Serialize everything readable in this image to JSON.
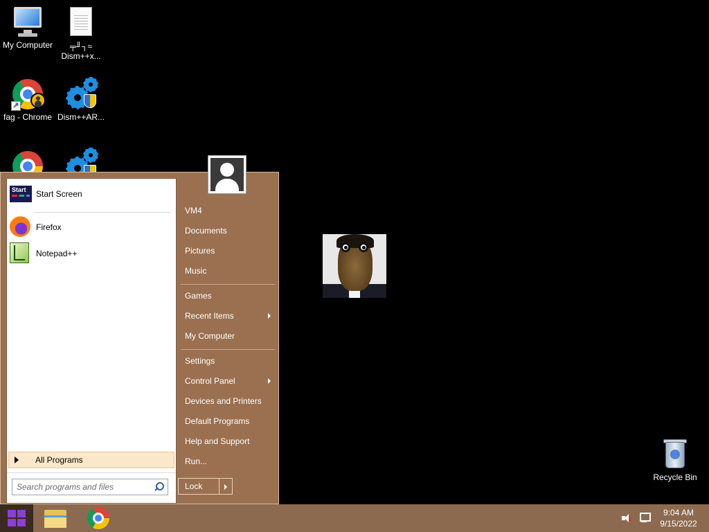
{
  "desktop": {
    "icons": [
      {
        "label": "My Computer",
        "icon": "computer-icon"
      },
      {
        "label": "╤╜┐≈",
        "label2": "Dism++x...",
        "icon": "document-icon"
      },
      {
        "label": "fag - Chrome",
        "icon": "chrome-icon"
      },
      {
        "label": "Dism++AR...",
        "icon": "gear-icon"
      },
      {
        "label": "",
        "icon": "chrome-icon"
      },
      {
        "label": "",
        "icon": "gear-icon"
      },
      {
        "label": "Recycle Bin",
        "icon": "recycle-bin-icon"
      }
    ]
  },
  "start_menu": {
    "pinned": [
      {
        "label": "Start Screen",
        "tile_text": "Start",
        "icon": "start-screen-icon"
      },
      {
        "label": "Firefox",
        "icon": "firefox-icon"
      },
      {
        "label": "Notepad++",
        "icon": "notepadpp-icon"
      }
    ],
    "all_programs": "All Programs",
    "search_placeholder": "Search programs and files",
    "right_items": [
      {
        "label": "VM4",
        "submenu": false
      },
      {
        "label": "Documents",
        "submenu": false
      },
      {
        "label": "Pictures",
        "submenu": false
      },
      {
        "label": "Music",
        "submenu": false
      },
      {
        "label": "Games",
        "submenu": false
      },
      {
        "label": "Recent Items",
        "submenu": true
      },
      {
        "label": "My Computer",
        "submenu": false
      },
      {
        "label": "Settings",
        "submenu": false
      },
      {
        "label": "Control Panel",
        "submenu": true
      },
      {
        "label": "Devices and Printers",
        "submenu": false
      },
      {
        "label": "Default Programs",
        "submenu": false
      },
      {
        "label": "Help and Support",
        "submenu": false
      },
      {
        "label": "Run...",
        "submenu": false
      }
    ],
    "lock_label": "Lock"
  },
  "taskbar": {
    "pinned": [
      "windows-start-icon",
      "file-explorer-icon",
      "chrome-icon"
    ],
    "tray_icons": [
      "speaker-muted-icon",
      "network-icon"
    ],
    "time": "9:04 AM",
    "date": "9/15/2022"
  },
  "colors": {
    "menu_bg": "#9b7050",
    "taskbar_bg": "#8c6a4f",
    "all_programs_highlight": "#fbe7c9"
  }
}
